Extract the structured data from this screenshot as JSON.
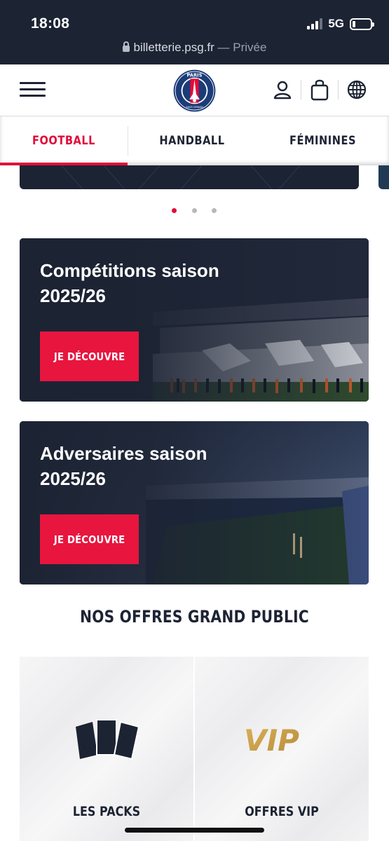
{
  "status_bar": {
    "time": "18:08",
    "network": "5G",
    "url": "billetterie.psg.fr",
    "separator": "—",
    "private_label": "Privée"
  },
  "header": {
    "logo_text_top": "PARIS",
    "logo_text_bottom": "SAINT-GERMAIN",
    "logo_year": "1970",
    "icons": [
      "menu-icon",
      "user-icon",
      "shopping-bag-icon",
      "globe-icon"
    ]
  },
  "tabs": [
    {
      "label": "FOOTBALL",
      "active": true
    },
    {
      "label": "HANDBALL",
      "active": false
    },
    {
      "label": "FÉMININES",
      "active": false
    }
  ],
  "carousel": {
    "active_index": 0,
    "count": 3
  },
  "cards": [
    {
      "title_line1": "Compétitions saison",
      "title_line2": "2025/26",
      "button": "JE DÉCOUVRE"
    },
    {
      "title_line1": "Adversaires saison",
      "title_line2": "2025/26",
      "button": "JE DÉCOUVRE"
    }
  ],
  "offers": {
    "title": "NOS OFFRES GRAND PUBLIC",
    "items": [
      {
        "label": "LES PACKS",
        "icon": "ticket-cards-icon"
      },
      {
        "label": "OFFRES VIP",
        "icon": "vip-logo-icon",
        "logo_text": "VIP"
      }
    ]
  },
  "colors": {
    "navy": "#1c2333",
    "accent_red": "#e30a3a",
    "vip_gold": "#c9a24a"
  }
}
